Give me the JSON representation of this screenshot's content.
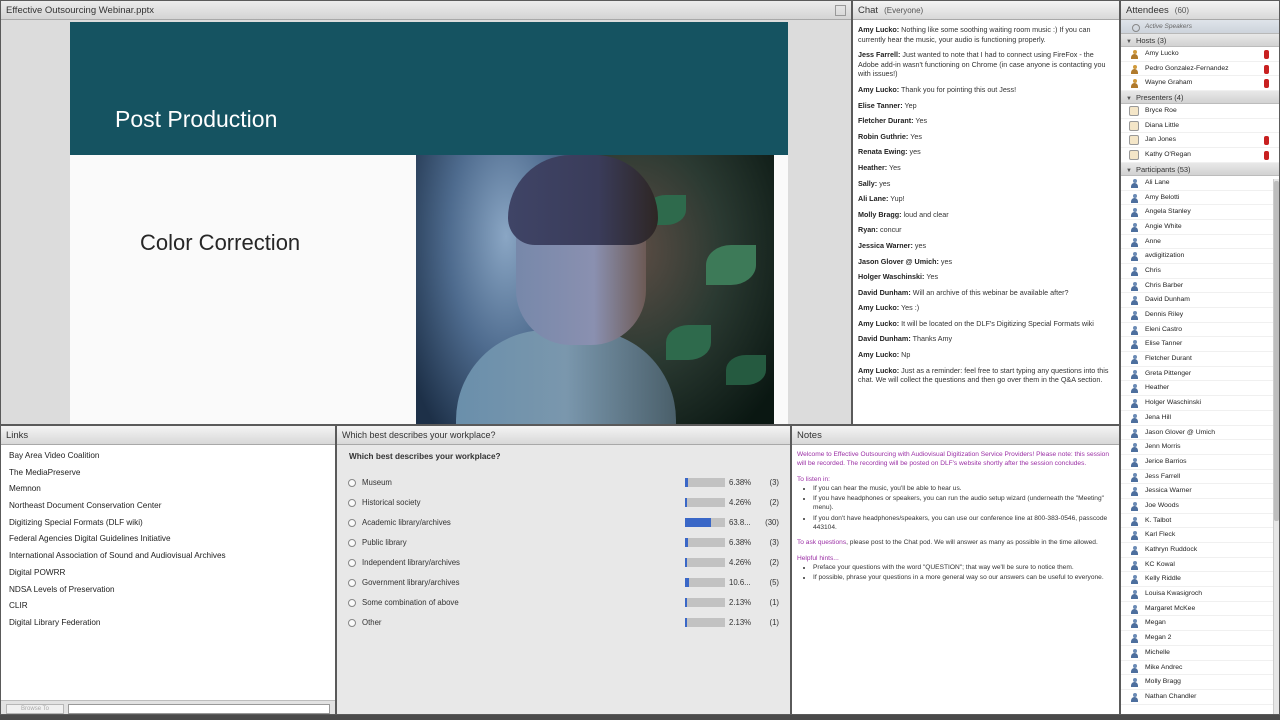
{
  "share": {
    "title": "Effective Outsourcing Webinar.pptx",
    "slide_title": "Post Production",
    "slide_subtitle": "Color Correction"
  },
  "chat": {
    "title": "Chat",
    "scope": "(Everyone)",
    "messages": [
      {
        "who": "Amy Lucko:",
        "text": "Nothing like some soothing waiting room music :) If you can currently hear the music, your audio is functioning properly."
      },
      {
        "who": "Jess Farrell:",
        "text": "Just wanted to note that I had to connect using FireFox - the Adobe add-in wasn't functioning on Chrome (in case anyone is contacting you with issues!)"
      },
      {
        "who": "Amy Lucko:",
        "text": "Thank you for pointing this out Jess!"
      },
      {
        "who": "Elise Tanner:",
        "text": "Yep"
      },
      {
        "who": "Fletcher Durant:",
        "text": "Yes"
      },
      {
        "who": "Robin Guthrie:",
        "text": "Yes"
      },
      {
        "who": "Renata Ewing:",
        "text": "yes"
      },
      {
        "who": "Heather:",
        "text": "Yes"
      },
      {
        "who": "Sally:",
        "text": "yes"
      },
      {
        "who": "Ali Lane:",
        "text": "Yup!"
      },
      {
        "who": "Molly Bragg:",
        "text": "loud and clear"
      },
      {
        "who": "Ryan:",
        "text": "concur"
      },
      {
        "who": "Jessica Warner:",
        "text": "yes"
      },
      {
        "who": "Jason Glover @ Umich:",
        "text": "yes"
      },
      {
        "who": "Holger Waschinski:",
        "text": "Yes"
      },
      {
        "who": "David Dunham:",
        "text": "Will an archive of this webinar be available after?"
      },
      {
        "who": "Amy Lucko:",
        "text": "Yes :)"
      },
      {
        "who": "Amy Lucko:",
        "text": "It will be located on the DLF's Digitizing Special Formats wiki"
      },
      {
        "who": "David Dunham:",
        "text": "Thanks Amy"
      },
      {
        "who": "Amy Lucko:",
        "text": "Np"
      },
      {
        "who": "Amy Lucko:",
        "text": "Just as a reminder: feel free to start typing any questions into this chat. We will collect the questions and then go over them in the Q&A section."
      }
    ]
  },
  "attendees": {
    "title": "Attendees",
    "count": "(60)",
    "active_speakers": "Active Speakers",
    "hosts_label": "Hosts (3)",
    "hosts": [
      "Amy Lucko",
      "Pedro Gonzalez-Fernandez",
      "Wayne Graham"
    ],
    "presenters_label": "Presenters (4)",
    "presenters": [
      "Bryce Roe",
      "Diana Little",
      "Jan Jones",
      "Kathy O'Regan"
    ],
    "participants_label": "Participants (53)",
    "participants": [
      "Ali Lane",
      "Amy Belotti",
      "Angela Stanley",
      "Angie White",
      "Anne",
      "avdigitization",
      "Chris",
      "Chris Barber",
      "David Dunham",
      "Dennis Riley",
      "Eleni Castro",
      "Elise Tanner",
      "Fletcher Durant",
      "Greta Pittenger",
      "Heather",
      "Holger Waschinski",
      "Jena Hill",
      "Jason Glover @ Umich",
      "Jenn Morris",
      "Jerice Barrios",
      "Jess Farrell",
      "Jessica Warner",
      "Joe Woods",
      "K. Talbot",
      "Karl Fleck",
      "Kathryn Ruddock",
      "KC Kowal",
      "Kelly Riddle",
      "Louisa Kwasigroch",
      "Margaret McKee",
      "Megan",
      "Megan 2",
      "Michelle",
      "Mike Andrec",
      "Molly Bragg",
      "Nathan Chandler"
    ]
  },
  "links": {
    "title": "Links",
    "items": [
      "Bay Area Video Coalition",
      "The MediaPreserve",
      "Memnon",
      "Northeast Document Conservation Center",
      "Digitizing Special Formats (DLF wiki)",
      "Federal Agencies Digital Guidelines Initiative",
      "International Association of Sound and Audiovisual Archives",
      "Digital POWRR",
      "NDSA Levels of Preservation",
      "CLIR",
      "Digital Library Federation"
    ],
    "browse_label": "Browse To"
  },
  "poll": {
    "title": "Which best describes your workplace?",
    "question": "Which best describes your workplace?",
    "options": [
      {
        "label": "Museum",
        "pct": "6.38%",
        "count": "(3)",
        "share": 0.0638
      },
      {
        "label": "Historical society",
        "pct": "4.26%",
        "count": "(2)",
        "share": 0.0426
      },
      {
        "label": "Academic library/archives",
        "pct": "63.8...",
        "count": "(30)",
        "share": 0.638
      },
      {
        "label": "Public library",
        "pct": "6.38%",
        "count": "(3)",
        "share": 0.0638
      },
      {
        "label": "Independent library/archives",
        "pct": "4.26%",
        "count": "(2)",
        "share": 0.0426
      },
      {
        "label": "Government library/archives",
        "pct": "10.6...",
        "count": "(5)",
        "share": 0.106
      },
      {
        "label": "Some combination of above",
        "pct": "2.13%",
        "count": "(1)",
        "share": 0.0213
      },
      {
        "label": "Other",
        "pct": "2.13%",
        "count": "(1)",
        "share": 0.0213
      }
    ]
  },
  "notes": {
    "title": "Notes",
    "welcome": "Welcome to Effective Outsourcing with Audiovisual Digitization Service Providers! Please note: this session will be recorded. The recording will be posted on DLF's website shortly after the session concludes.",
    "listen_head": "To listen in:",
    "listen_items": [
      "If you can hear the music, you'll be able to hear us.",
      "If you have headphones or speakers, you can run the audio setup wizard (underneath the \"Meeting\" menu).",
      "If you don't have headphones/speakers, you can use our conference line at 800-383-0546, passcode 443104."
    ],
    "ask_head": "To ask questions",
    "ask_text": ", please post to the Chat pod. We will answer as many as possible in the time allowed.",
    "hints_head": "Helpful hints...",
    "hints_items": [
      "Preface your questions with the word \"QUESTION\"; that way we'll be sure to notice them.",
      "If possible, phrase your questions in a more general way so our answers can be useful to everyone."
    ]
  },
  "colors": {
    "slide_header": "#155361",
    "poll_bar_fill": "#3a67c7",
    "notes_accent": "#9b2fa5",
    "mic_muted": "#c82020"
  }
}
